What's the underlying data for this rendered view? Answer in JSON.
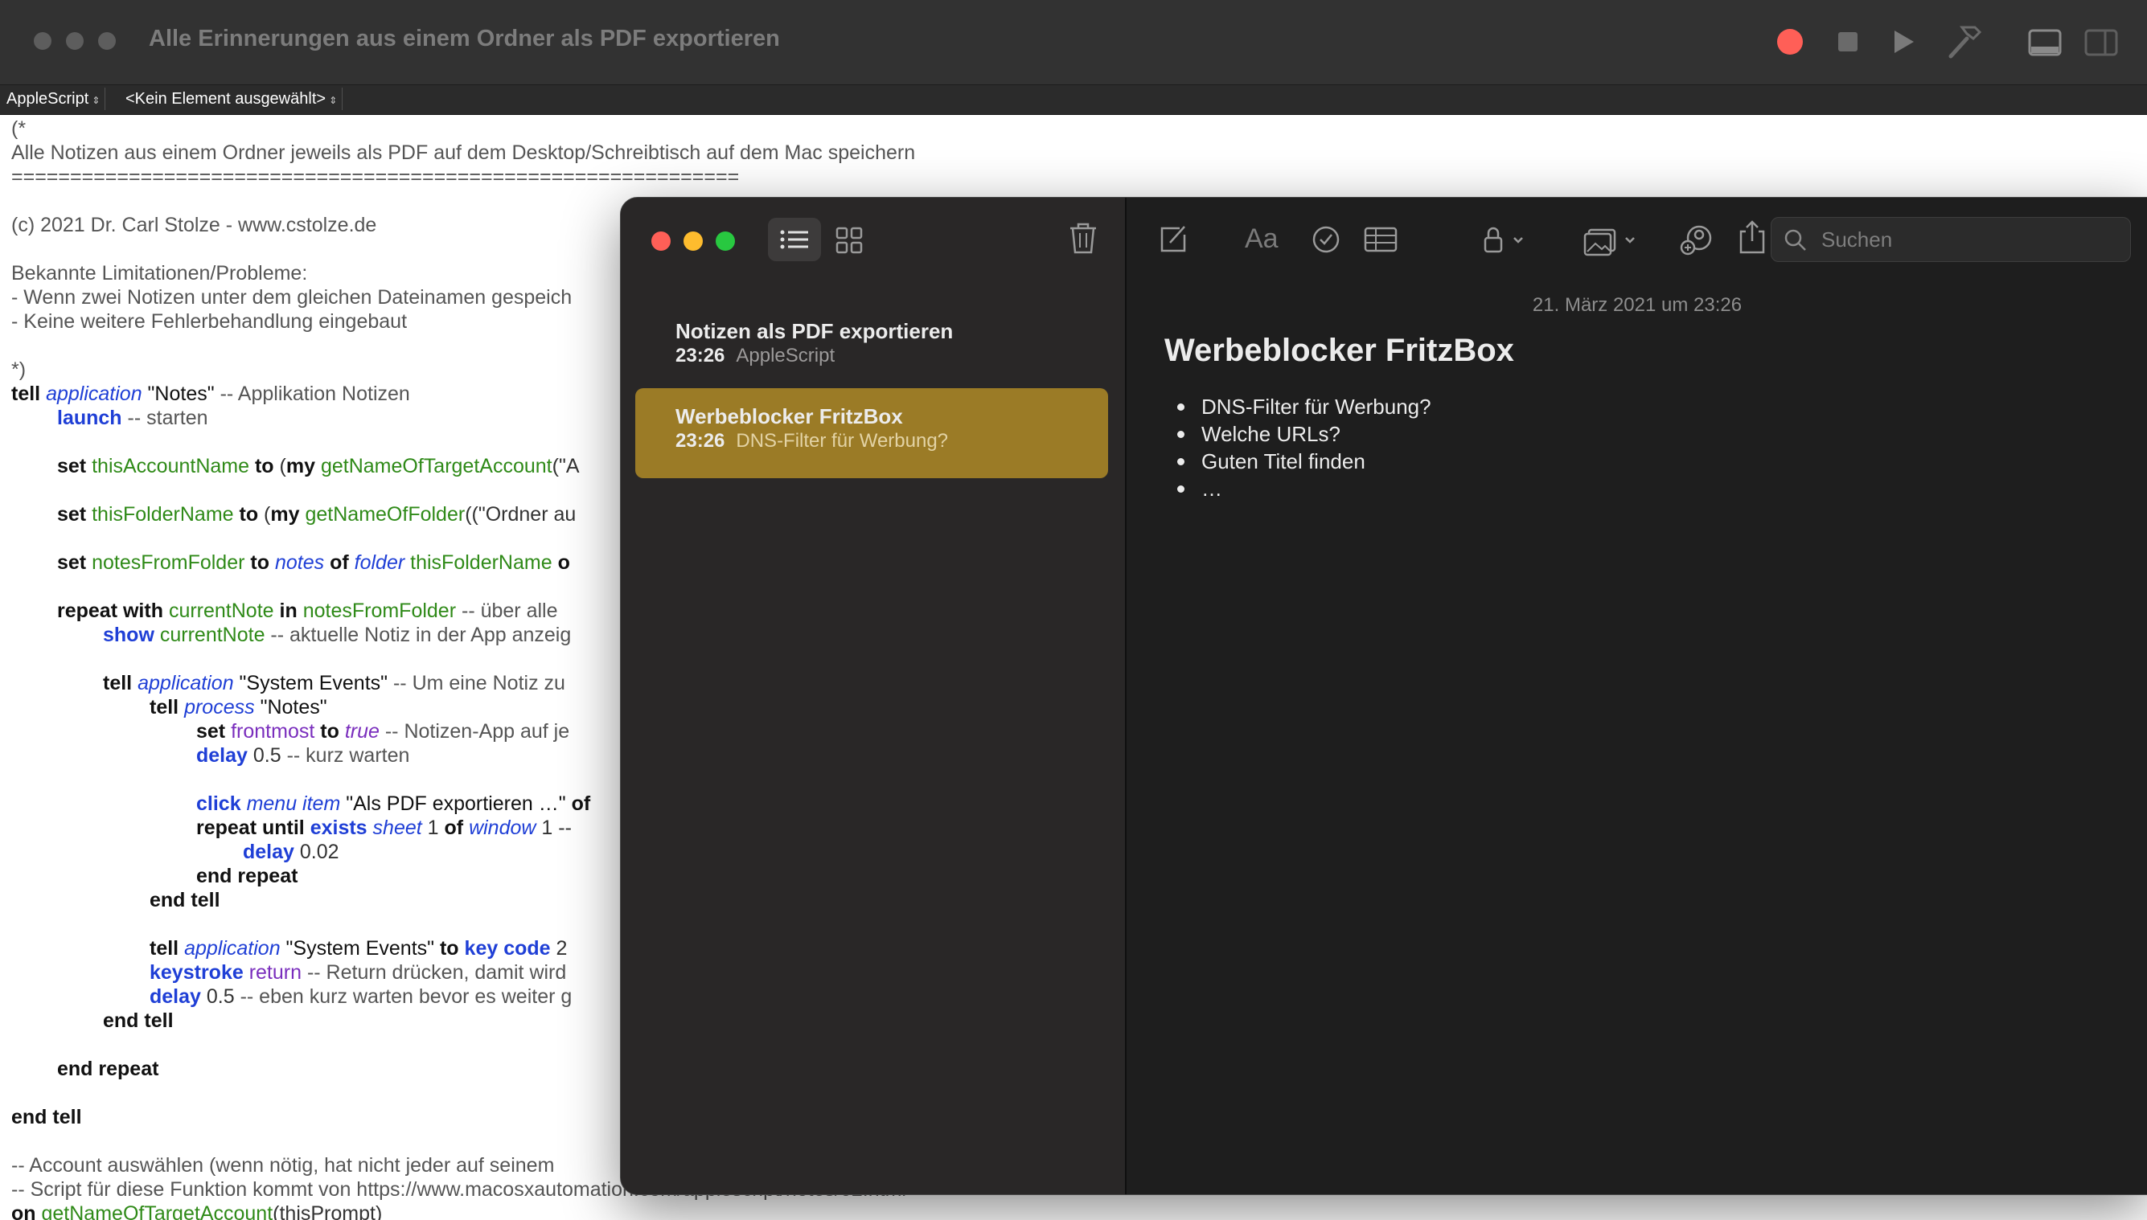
{
  "script_editor": {
    "title": "Alle Erinnerungen aus einem Ordner als PDF exportieren",
    "language_popup": "AppleScript",
    "element_popup": "<Kein Element ausgewählt>",
    "code_lines": {
      "l1": "(*",
      "l2": "Alle Notizen aus einem Ordner jeweils als PDF auf dem Desktop/Schreibtisch auf dem Mac speichern",
      "l3": "==============================================================",
      "l5": "(c) 2021 Dr. Carl Stolze - www.cstolze.de",
      "l7": "Bekannte Limitationen/Probleme:",
      "l8": "- Wenn zwei Notizen unter dem gleichen Dateinamen gespeich",
      "l9": "- Keine weitere Fehlerbehandlung eingebaut",
      "l11": "*)",
      "l12_kw": "tell",
      "l12_cls": "application",
      "l12_str": " \"Notes\"",
      "l12_cmt": " -- Applikation Notizen",
      "l13_cmd": "launch",
      "l13_cmt": " -- starten",
      "l15_kw": "set",
      "l15_var": "thisAccountName",
      "l15_kw2": "to",
      "l15_p": " (",
      "l15_kw3": "my",
      "l15_var2": "getNameOfTargetAccount",
      "l15_rest": "(\"A",
      "l17_kw": "set",
      "l17_var": "thisFolderName",
      "l17_kw2": "to",
      "l17_p": " (",
      "l17_kw3": "my",
      "l17_var2": "getNameOfFolder",
      "l17_rest": "((\"Ordner au",
      "l19_kw": "set",
      "l19_var": "notesFromFolder",
      "l19_kw2": "to",
      "l19_cls": "notes",
      "l19_kw3": "of",
      "l19_cls2": "folder",
      "l19_var2": "thisFolderName",
      "l19_rest": "o",
      "l21_kw": "repeat with",
      "l21_var": "currentNote",
      "l21_kw2": "in",
      "l21_var2": "notesFromFolder",
      "l21_cmt": " -- über alle",
      "l22_cmd": "show",
      "l22_var": "currentNote",
      "l22_cmt": " -- aktuelle Notiz in der App anzeig",
      "l24_kw": "tell",
      "l24_cls": "application",
      "l24_str": " \"System Events\"",
      "l24_cmt": " -- Um eine Notiz zu",
      "l25_kw": "tell",
      "l25_cls": "process",
      "l25_str": " \"Notes\"",
      "l26_kw": "set",
      "l26_prop": "frontmost",
      "l26_kw2": "to",
      "l26_prop2": "true",
      "l26_cmt": " -- Notizen-App auf je",
      "l27_cmd": "delay",
      "l27_num": " 0.5",
      "l27_cmt": " -- kurz warten",
      "l29_cmd": "click",
      "l29_cls": "menu item",
      "l29_str": " \"Als PDF exportieren …\"",
      "l29_rest": " of",
      "l30_kw": "repeat until",
      "l30_cmd": "exists",
      "l30_cls": "sheet",
      "l30_num": " 1 ",
      "l30_kw2": "of",
      "l30_cls2": "window",
      "l30_rest": " 1 --",
      "l31_cmd": "delay",
      "l31_num": " 0.02",
      "l32": "end repeat",
      "l33": "end tell",
      "l35_kw": "tell",
      "l35_cls": "application",
      "l35_str": " \"System Events\" ",
      "l35_kw2": "to",
      "l35_cmd": "key code",
      "l35_rest": " 2",
      "l36_cmd": "keystroke",
      "l36_prop": "return",
      "l36_cmt": " -- Return drücken, damit wird",
      "l37_cmd": "delay",
      "l37_num": " 0.5",
      "l37_cmt": " -- eben kurz warten bevor es weiter g",
      "l38": "end tell",
      "l40": "end repeat",
      "l42": "end tell",
      "l44": "-- Account auswählen (wenn nötig, hat nicht jeder auf seinem",
      "l45": "-- Script für diese Funktion kommt von https://www.macosxautomation.com/applescript/notes/02.html",
      "l46_kw": "on",
      "l46_var": "getNameOfTargetAccount",
      "l46_rest": "(thisPrompt)"
    }
  },
  "notes_app": {
    "search_placeholder": "Suchen",
    "format_label": "Aa",
    "notes": [
      {
        "title": "Notizen als PDF exportieren",
        "time": "23:26",
        "preview": "AppleScript"
      },
      {
        "title": "Werbeblocker FritzBox",
        "time": "23:26",
        "preview": "DNS-Filter für Werbung?"
      }
    ],
    "selected_note": {
      "date": "21. März 2021 um 23:26",
      "title": "Werbeblocker FritzBox",
      "bullets": [
        "DNS-Filter für Werbung?",
        "Welche URLs?",
        "Guten Titel finden",
        "…"
      ]
    },
    "colors": {
      "selection": "#9b7b26",
      "close": "#ff5f57",
      "minimize": "#febc2e",
      "zoom": "#28c840"
    }
  }
}
